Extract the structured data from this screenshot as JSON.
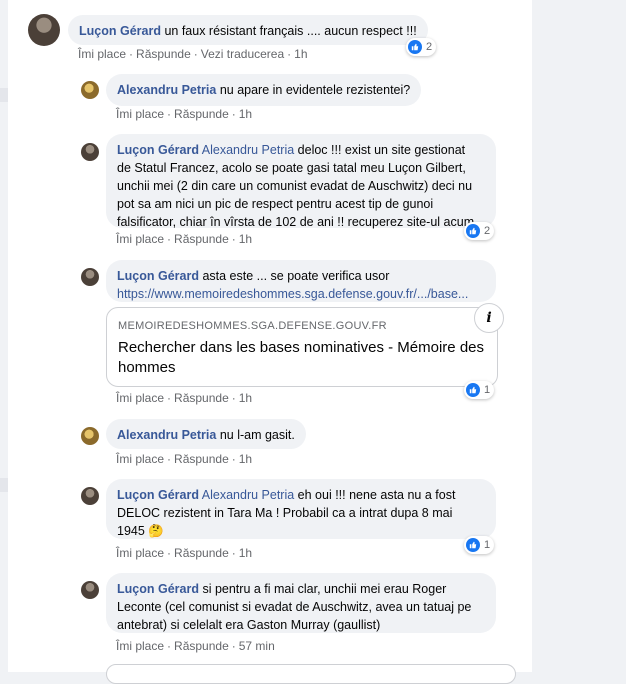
{
  "actions": {
    "like": "Îmi place",
    "reply": "Răspunde",
    "translate": "Vezi traducerea",
    "sep": "·"
  },
  "comments": [
    {
      "author": "Luçon Gérard",
      "text": "un faux résistant français .... aucun respect !!!",
      "time": "1h",
      "reactions": "2"
    },
    {
      "author": "Alexandru Petria",
      "text": "nu apare in evidentele rezistentei?",
      "time": "1h"
    },
    {
      "author": "Luçon Gérard",
      "mention": "Alexandru Petria",
      "lines": [
        "deloc !!! exist un site gestionat",
        "de Statul Francez, acolo se poate gasi tatal meu Luçon Gilbert,",
        "unchii mei (2 din care un comunist evadat de Auschwitz) deci nu",
        "pot sa am nici un pic de respect pentru acest tip de gunoi",
        "falsificator, chiar în vîrsta de 102 de ani !! recuperez site-ul acum"
      ],
      "time": "1h",
      "reactions": "2"
    },
    {
      "author": "Luçon Gérard",
      "text": "asta este ... se poate verifica usor",
      "link": "https://www.memoiredeshommes.sga.defense.gouv.fr/.../base...",
      "card": {
        "domain": "MEMOIREDESHOMMES.SGA.DEFENSE.GOUV.FR",
        "title": "Rechercher dans les bases nominatives - Mémoire des hommes"
      },
      "time": "1h",
      "reactions": "1"
    },
    {
      "author": "Alexandru Petria",
      "text": "nu l-am gasit.",
      "time": "1h"
    },
    {
      "author": "Luçon Gérard",
      "mention": "Alexandru Petria",
      "lines": [
        "eh oui !!! nene asta nu a fost",
        "DELOC rezistent in Tara Ma ! Probabil ca a intrat dupa 8 mai",
        "1945"
      ],
      "emoji": "🤔",
      "time": "1h",
      "reactions": "1"
    },
    {
      "author": "Luçon Gérard",
      "lines": [
        "si pentru a fi mai clar, unchii mei erau Roger",
        "Leconte (cel comunist si evadat de Auschwitz, avea un tatuaj pe",
        "antebrat) si celelalt era Gaston Murray (gaullist)"
      ],
      "time": "57 min"
    }
  ],
  "colors": {
    "author": "#385898",
    "like": "#1877f2",
    "bubble": "#f0f2f5"
  }
}
